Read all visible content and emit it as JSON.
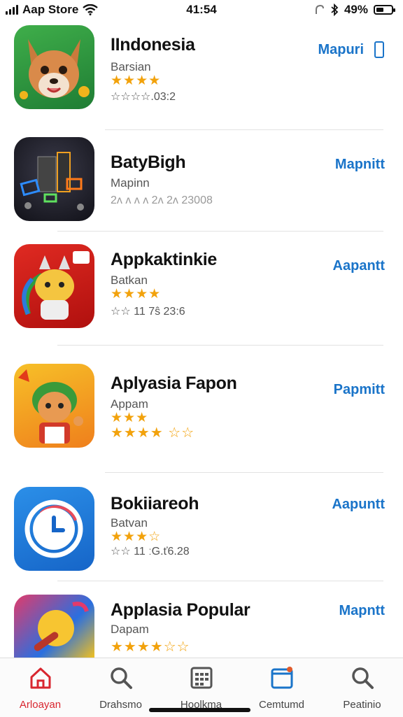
{
  "status_bar": {
    "carrier": "Aap Store",
    "time": "41:54",
    "battery": "49%",
    "battery_level": 0.49
  },
  "colors": {
    "accent": "#1a74c9",
    "tab_active": "#d8262f",
    "star_gold": "#f2a20c"
  },
  "apps": [
    {
      "name": "IIndonesia",
      "category": "Barsian",
      "stars": "★★★★",
      "rating_line": "☆☆☆☆.03:2",
      "get_label": "Mapuri",
      "icon": "fox-icon"
    },
    {
      "name": "BatyBigh",
      "category": "Mapinn",
      "stars": "",
      "rating_line": "2ʌ ʌ ʌ ʌ 2ʌ 2ʌ 23008",
      "get_label": "Mapnitt",
      "icon": "game-blocks-icon"
    },
    {
      "name": "Appkaktinkie",
      "category": "Batkan",
      "stars": "★★★★",
      "rating_line": "☆☆ 11 7ŝ 23:6",
      "get_label": "Aapantt",
      "icon": "cat-mascot-icon"
    },
    {
      "name": "Aplyasia Fapon",
      "category": "Appam",
      "stars": "★★★",
      "rating_line": "★★★★ ☆☆",
      "get_label": "Papmitt",
      "icon": "fox-girl-icon"
    },
    {
      "name": "Bokiiareoh",
      "category": "Batvan",
      "stars": "★★★☆",
      "rating_line": "☆☆ 11 ːG.ť6.28",
      "get_label": "Aapuntt",
      "icon": "clock-icon"
    },
    {
      "name": "Applasia Popular",
      "category": "Dapam",
      "stars": "",
      "rating_line": "★★★★☆☆",
      "get_label": "Mapntt",
      "icon": "paint-icon"
    }
  ],
  "tabs": [
    {
      "label": "Arloayan",
      "icon": "home-icon",
      "active": true
    },
    {
      "label": "Drahsmo",
      "icon": "search-icon",
      "active": false
    },
    {
      "label": "Hoolkma",
      "icon": "calendar-icon",
      "active": false
    },
    {
      "label": "Cemtumd",
      "icon": "window-icon",
      "active": false
    },
    {
      "label": "Peatinio",
      "icon": "search-icon",
      "active": false
    }
  ]
}
